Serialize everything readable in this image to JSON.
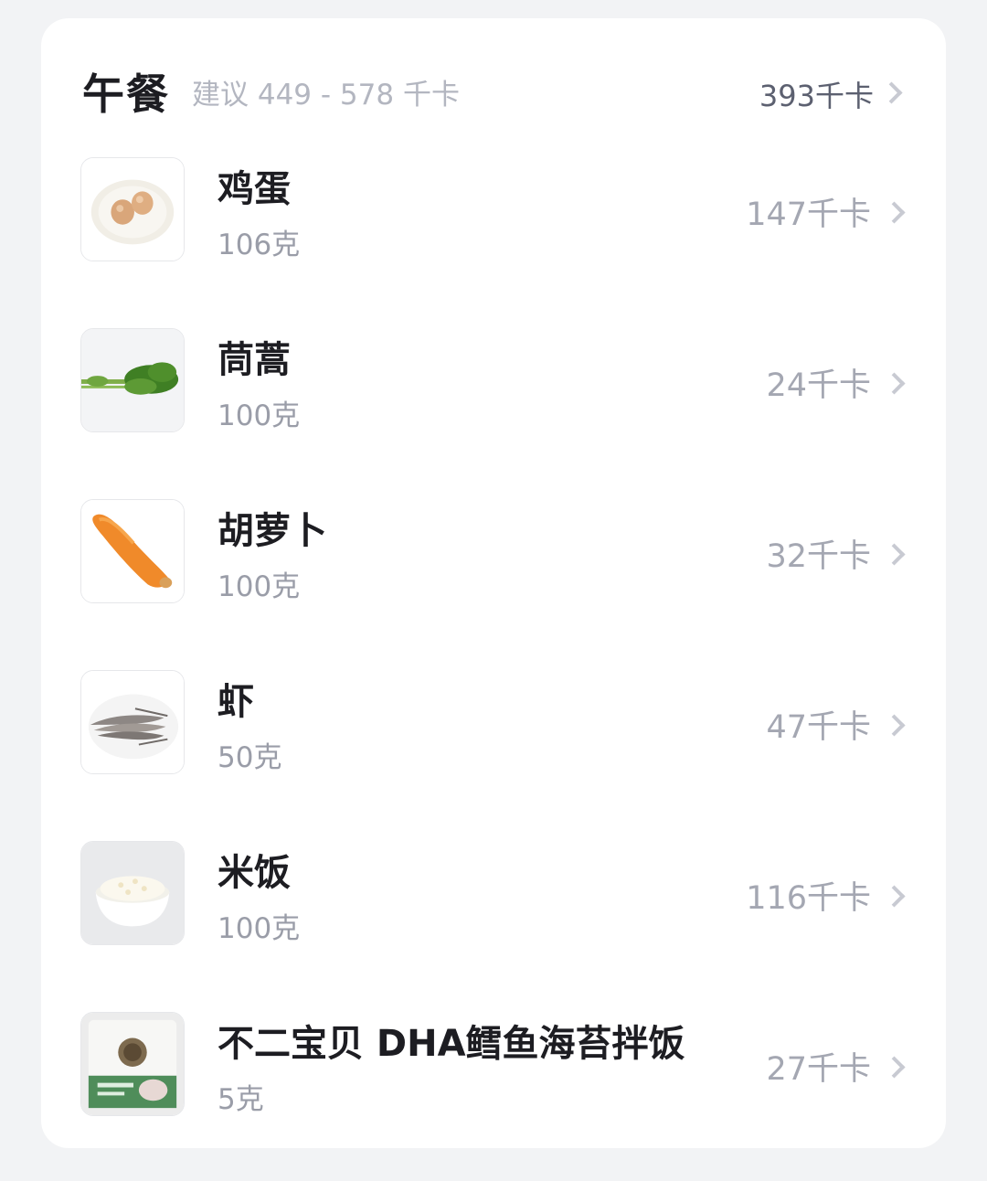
{
  "meal": {
    "title": "午餐",
    "suggestion": "建议 449 - 578 千卡",
    "total": "393千卡"
  },
  "items": [
    {
      "name": "鸡蛋",
      "amount": "106克",
      "kcal": "147千卡",
      "icon": "egg-image"
    },
    {
      "name": "茼蒿",
      "amount": "100克",
      "kcal": "24千卡",
      "icon": "crown-daisy-image"
    },
    {
      "name": "胡萝卜",
      "amount": "100克",
      "kcal": "32千卡",
      "icon": "carrot-image"
    },
    {
      "name": "虾",
      "amount": "50克",
      "kcal": "47千卡",
      "icon": "shrimp-image"
    },
    {
      "name": "米饭",
      "amount": "100克",
      "kcal": "116千卡",
      "icon": "rice-image"
    },
    {
      "name": "不二宝贝 DHA鳕鱼海苔拌饭",
      "amount": "5克",
      "kcal": "27千卡",
      "icon": "seasoning-package-image"
    }
  ]
}
